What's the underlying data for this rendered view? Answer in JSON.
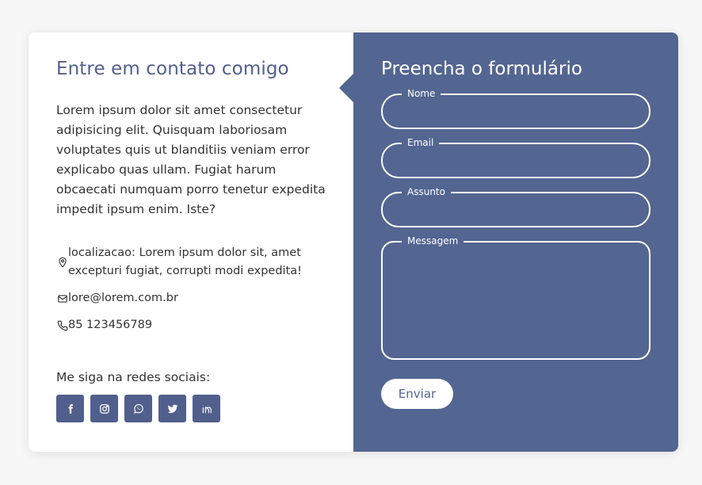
{
  "contact": {
    "title": "Entre em contato comigo",
    "description": "Lorem ipsum dolor sit amet consectetur adipisicing elit. Quisquam laboriosam voluptates quis ut blanditiis veniam error explicabo quas ullam. Fugiat harum obcaecati numquam porro tenetur expedita impedit ipsum enim. Iste?",
    "location": "localizacao: Lorem ipsum dolor sit, amet excepturi fugiat, corrupti modi expedita!",
    "email": "lore@lorem.com.br",
    "phone": "85 123456789",
    "social_label": "Me siga na redes sociais:",
    "socials": [
      "facebook-icon",
      "instagram-icon",
      "whatsapp-icon",
      "twitter-icon",
      "linkedin-icon"
    ]
  },
  "form": {
    "title": "Preencha o formulário",
    "fields": [
      {
        "label": "Nome",
        "value": ""
      },
      {
        "label": "Email",
        "value": ""
      },
      {
        "label": "Assunto",
        "value": ""
      },
      {
        "label": "Messagem",
        "value": ""
      }
    ],
    "submit_label": "Enviar"
  },
  "colors": {
    "accent": "#536591",
    "heading": "#515f8c",
    "background": "#f7f7f7",
    "card": "#ffffff",
    "text": "#333333"
  }
}
